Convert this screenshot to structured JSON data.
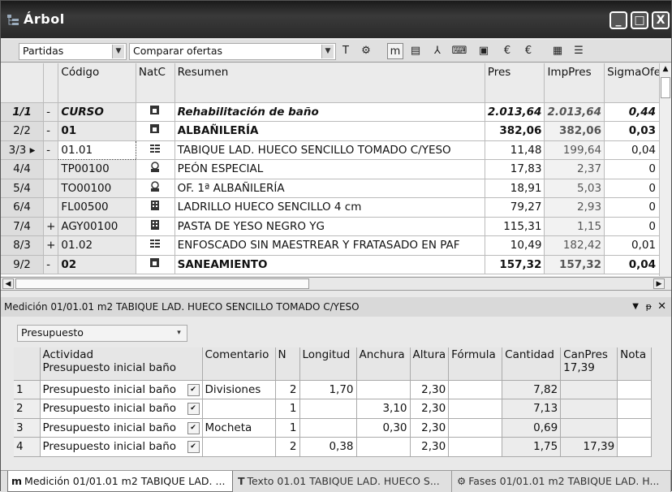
{
  "window": {
    "title": "Árbol",
    "buttons": [
      "_",
      "□",
      "X"
    ]
  },
  "toolbar": {
    "partidas": "Partidas",
    "comparar": "Comparar ofertas",
    "icons": [
      {
        "name": "text-tool-icon",
        "glyph": "T"
      },
      {
        "name": "phases-icon",
        "glyph": "⚙"
      },
      {
        "name": "measurement-icon",
        "glyph": "m"
      },
      {
        "name": "document-icon",
        "glyph": "▤"
      },
      {
        "name": "tree-icon",
        "glyph": "⅄"
      },
      {
        "name": "key-icon",
        "glyph": "⌨"
      },
      {
        "name": "window-icon",
        "glyph": "▣"
      },
      {
        "name": "price-icon",
        "glyph": "€"
      },
      {
        "name": "price-compare-icon",
        "glyph": "€"
      },
      {
        "name": "grid-icon",
        "glyph": "▦"
      },
      {
        "name": "list-icon",
        "glyph": "☰"
      }
    ]
  },
  "main_table": {
    "headers": [
      "Código",
      "NatC",
      "Resumen",
      "Pres",
      "ImpPres",
      "SigmaOfer"
    ],
    "rows": [
      {
        "n": "1/1",
        "exp": "-",
        "code": "CURSO",
        "natc": "chapter",
        "resumen": "Rehabilitación de baño",
        "pres": "2.013,64",
        "imp": "2.013,64",
        "sigma": "0,44",
        "style": "ital"
      },
      {
        "n": "2/2",
        "exp": "-",
        "code": "01",
        "natc": "chapter",
        "resumen": "ALBAÑILERÍA",
        "pres": "382,06",
        "imp": "382,06",
        "sigma": "0,03",
        "style": "bold"
      },
      {
        "n": "3/3 ▸",
        "exp": "-",
        "code": "01.01",
        "natc": "partida",
        "resumen": "TABIQUE LAD. HUECO SENCILLO TOMADO C/YESO",
        "pres": "11,48",
        "imp": "199,64",
        "sigma": "0,04",
        "style": "sel"
      },
      {
        "n": "4/4",
        "exp": "",
        "code": "TP00100",
        "natc": "worker",
        "resumen": "PEÓN ESPECIAL",
        "pres": "17,83",
        "imp": "2,37",
        "sigma": "0",
        "style": ""
      },
      {
        "n": "5/4",
        "exp": "",
        "code": "TO00100",
        "natc": "worker",
        "resumen": "OF. 1ª ALBAÑILERÍA",
        "pres": "18,91",
        "imp": "5,03",
        "sigma": "0",
        "style": ""
      },
      {
        "n": "6/4",
        "exp": "",
        "code": "FL00500",
        "natc": "material",
        "resumen": "LADRILLO HUECO SENCILLO 4 cm",
        "pres": "79,27",
        "imp": "2,93",
        "sigma": "0",
        "style": ""
      },
      {
        "n": "7/4",
        "exp": "+",
        "code": "AGY00100",
        "natc": "material",
        "resumen": "PASTA DE YESO NEGRO YG",
        "pres": "115,31",
        "imp": "1,15",
        "sigma": "0",
        "style": ""
      },
      {
        "n": "8/3",
        "exp": "+",
        "code": "01.02",
        "natc": "partida",
        "resumen": "ENFOSCADO SIN MAESTREAR Y FRATASADO EN PAF",
        "pres": "10,49",
        "imp": "182,42",
        "sigma": "0,01",
        "style": ""
      },
      {
        "n": "9/2",
        "exp": "-",
        "code": "02",
        "natc": "chapter",
        "resumen": "SANEAMIENTO",
        "pres": "157,32",
        "imp": "157,32",
        "sigma": "0,04",
        "style": "bold"
      }
    ]
  },
  "panel": {
    "title": "Medición 01/01.01 m2 TABIQUE LAD. HUECO SENCILLO TOMADO C/YESO",
    "dropdown": "Presupuesto",
    "headers": {
      "actividad": "Actividad",
      "actividad_sub": "Presupuesto inicial baño",
      "comentario": "Comentario",
      "n": "N",
      "longitud": "Longitud",
      "anchura": "Anchura",
      "altura": "Altura",
      "formula": "Fórmula",
      "cantidad": "Cantidad",
      "canpres": "CanPres",
      "canpres_sub": "17,39",
      "nota": "Nota"
    },
    "rows": [
      {
        "idx": "1",
        "act": "Presupuesto inicial baño",
        "com": "Divisiones",
        "n": "2",
        "lon": "1,70",
        "anc": "",
        "alt": "2,30",
        "cant": "7,82",
        "canpres": ""
      },
      {
        "idx": "2",
        "act": "Presupuesto inicial baño",
        "com": "",
        "n": "1",
        "lon": "",
        "anc": "3,10",
        "alt": "2,30",
        "cant": "7,13",
        "canpres": ""
      },
      {
        "idx": "3",
        "act": "Presupuesto inicial baño",
        "com": "Mocheta",
        "n": "1",
        "lon": "",
        "anc": "0,30",
        "alt": "2,30",
        "cant": "0,69",
        "canpres": ""
      },
      {
        "idx": "4",
        "act": "Presupuesto inicial baño",
        "com": "",
        "n": "2",
        "lon": "0,38",
        "anc": "",
        "alt": "2,30",
        "cant": "1,75",
        "canpres": "17,39"
      }
    ]
  },
  "tabs": [
    {
      "label": "Medición 01/01.01 m2 TABIQUE LAD. ...",
      "icon": "m"
    },
    {
      "label": "Texto 01.01 TABIQUE LAD. HUECO S...",
      "icon": "T"
    },
    {
      "label": "Fases 01/01.01 m2 TABIQUE LAD. H...",
      "icon": "⚙"
    }
  ]
}
